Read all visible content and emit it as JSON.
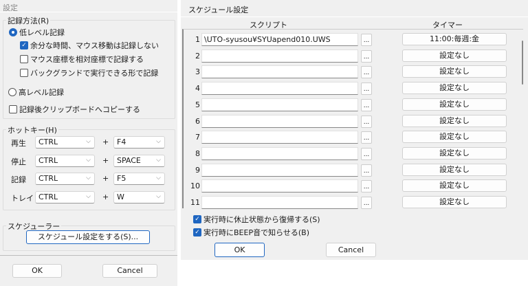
{
  "settings": {
    "title": "設定",
    "record_method": {
      "label": "記録方法(R)",
      "low_level": "低レベル記録",
      "opt_skip_idle": "余分な時間、マウス移動は記録しない",
      "opt_relative": "マウス座標を相対座標で記録する",
      "opt_background": "バックグランドで実行できる形で記録",
      "high_level": "高レベル記録",
      "copy_clipboard": "記録後クリップボードへコピーする",
      "selected": "low_level",
      "checked": {
        "skip_idle": true,
        "relative": false,
        "background": false,
        "copy_clipboard": false
      }
    },
    "hotkey": {
      "label": "ホットキー(H)",
      "rows": [
        {
          "label": "再生",
          "mod": "CTRL",
          "key": "F4"
        },
        {
          "label": "停止",
          "mod": "CTRL",
          "key": "SPACE"
        },
        {
          "label": "記録",
          "mod": "CTRL",
          "key": "F5"
        },
        {
          "label": "トレイ",
          "mod": "CTRL",
          "key": "W"
        }
      ],
      "plus": "+"
    },
    "scheduler": {
      "label": "スケジューラー",
      "button": "スケジュール設定をする(S)..."
    },
    "ok": "OK",
    "cancel": "Cancel"
  },
  "schedule": {
    "title": "スケジュール設定",
    "col_script": "スクリプト",
    "col_timer": "タイマー",
    "browse": "...",
    "rows": [
      {
        "n": "1",
        "script": "\\UTO-syusou¥SYUapend010.UWS",
        "timer": "11:00:毎週:金"
      },
      {
        "n": "2",
        "script": "",
        "timer": "設定なし"
      },
      {
        "n": "3",
        "script": "",
        "timer": "設定なし"
      },
      {
        "n": "4",
        "script": "",
        "timer": "設定なし"
      },
      {
        "n": "5",
        "script": "",
        "timer": "設定なし"
      },
      {
        "n": "6",
        "script": "",
        "timer": "設定なし"
      },
      {
        "n": "7",
        "script": "",
        "timer": "設定なし"
      },
      {
        "n": "8",
        "script": "",
        "timer": "設定なし"
      },
      {
        "n": "9",
        "script": "",
        "timer": "設定なし"
      },
      {
        "n": "10",
        "script": "",
        "timer": "設定なし"
      },
      {
        "n": "11",
        "script": "",
        "timer": "設定なし"
      }
    ],
    "resume_label": "実行時に休止状態から復帰する(S)",
    "beep_label": "実行時にBEEP音で知らせる(B)",
    "resume_checked": true,
    "beep_checked": true,
    "ok": "OK",
    "cancel": "Cancel"
  }
}
